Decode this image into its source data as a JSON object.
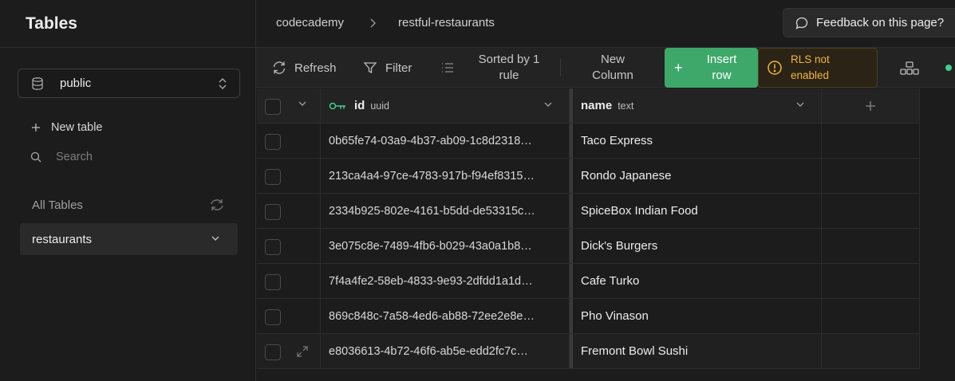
{
  "sidebar": {
    "title": "Tables",
    "schema": "public",
    "new_table": "New table",
    "search_placeholder": "Search",
    "all_tables": "All Tables",
    "tables": [
      "restaurants"
    ]
  },
  "breadcrumb": [
    "codecademy",
    "restful-restaurants"
  ],
  "feedback": "Feedback on this page?",
  "toolbar": {
    "refresh": "Refresh",
    "filter": "Filter",
    "sort_line1": "Sorted by 1",
    "sort_line2": "rule",
    "new_col_line1": "New",
    "new_col_line2": "Column",
    "insert_line1": "Insert",
    "insert_line2": "row",
    "rls_line1": "RLS not",
    "rls_line2": "enabled"
  },
  "columns": [
    {
      "name": "id",
      "type": "uuid"
    },
    {
      "name": "name",
      "type": "text"
    }
  ],
  "rows": [
    {
      "id": "0b65fe74-03a9-4b37-ab09-1c8d2318…",
      "name": "Taco Express"
    },
    {
      "id": "213ca4a4-97ce-4783-917b-f94ef8315…",
      "name": "Rondo Japanese"
    },
    {
      "id": "2334b925-802e-4161-b5dd-de53315c…",
      "name": "SpiceBox Indian Food"
    },
    {
      "id": "3e075c8e-7489-4fb6-b029-43a0a1b8…",
      "name": "Dick's Burgers"
    },
    {
      "id": "7f4a4fe2-58eb-4833-9e93-2dfdd1a1d…",
      "name": "Cafe Turko"
    },
    {
      "id": "869c848c-7a58-4ed6-ab88-72ee2e8e…",
      "name": "Pho Vinason"
    },
    {
      "id": "e8036613-4b72-46f6-ab5e-edd2fc7c…",
      "name": "Fremont Bowl Sushi"
    }
  ],
  "colors": {
    "accent_green": "#3ea86b",
    "warning": "#f0b53e",
    "status_dot": "#3ecf8e"
  }
}
